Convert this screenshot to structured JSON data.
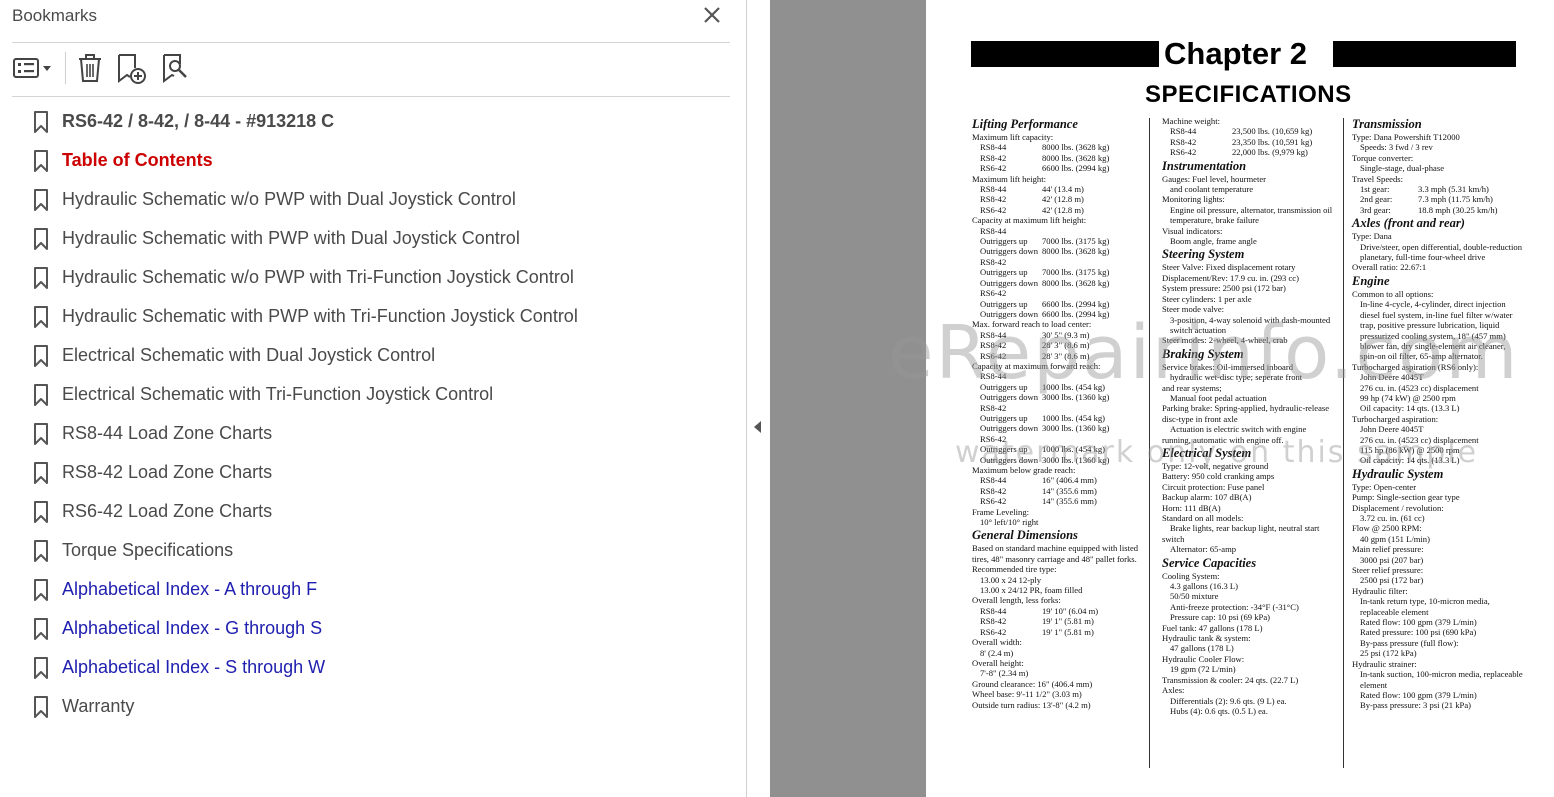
{
  "panel": {
    "title": "Bookmarks",
    "close_icon": "close-icon",
    "toolbar": [
      {
        "name": "options-menu-button",
        "icon": "list-options-icon"
      },
      {
        "name": "delete-bookmark-button",
        "icon": "trash-icon"
      },
      {
        "name": "new-bookmark-button",
        "icon": "add-bookmark-icon"
      },
      {
        "name": "find-bookmark-button",
        "icon": "search-bookmark-icon"
      }
    ],
    "bookmarks": [
      {
        "label": "RS6-42 / 8-42, / 8-44 - #913218 C",
        "style": "bold"
      },
      {
        "label": "Table of Contents",
        "style": "red"
      },
      {
        "label": "Hydraulic Schematic w/o PWP with Dual Joystick Control",
        "style": "normal"
      },
      {
        "label": "Hydraulic Schematic with PWP with Dual Joystick Control",
        "style": "normal"
      },
      {
        "label": "Hydraulic Schematic w/o PWP with Tri-Function Joystick Control",
        "style": "normal"
      },
      {
        "label": "Hydraulic Schematic with PWP with Tri-Function Joystick Control",
        "style": "normal"
      },
      {
        "label": "Electrical Schematic with Dual Joystick Control",
        "style": "normal"
      },
      {
        "label": "Electrical Schematic with Tri-Function Joystick Control",
        "style": "normal"
      },
      {
        "label": "RS8-44  Load Zone Charts",
        "style": "normal"
      },
      {
        "label": "RS8-42 Load Zone Charts",
        "style": "normal"
      },
      {
        "label": "RS6-42 Load Zone Charts",
        "style": "normal"
      },
      {
        "label": "Torque Specifications",
        "style": "normal"
      },
      {
        "label": "Alphabetical Index - A through F",
        "style": "blue"
      },
      {
        "label": "Alphabetical Index - G through S",
        "style": "blue"
      },
      {
        "label": "Alphabetical Index - S through W",
        "style": "blue"
      },
      {
        "label": "Warranty",
        "style": "normal"
      }
    ],
    "colors": {
      "red": "#cc0000",
      "blue": "#2020b0",
      "text": "#4a4a4a"
    }
  },
  "page": {
    "chapter": "Chapter 2",
    "title": "SPECIFICATIONS",
    "watermark": "eRepairinfo.com",
    "watermark_sub": "watermark only on this sample",
    "col1": [
      {
        "t": "h",
        "v": "Lifting Performance"
      },
      {
        "t": "p",
        "v": "Maximum lift capacity:"
      },
      {
        "t": "r",
        "a": "RS8-44",
        "b": "8000 lbs. (3628 kg)"
      },
      {
        "t": "r",
        "a": "RS8-42",
        "b": "8000 lbs. (3628 kg)"
      },
      {
        "t": "r",
        "a": "RS6-42",
        "b": "6600 lbs. (2994 kg)"
      },
      {
        "t": "p",
        "v": "Maximum lift height:"
      },
      {
        "t": "r",
        "a": "RS8-44",
        "b": "44' (13.4 m)"
      },
      {
        "t": "r",
        "a": "RS8-42",
        "b": "42' (12.8 m)"
      },
      {
        "t": "r",
        "a": "RS6-42",
        "b": "42' (12.8 m)"
      },
      {
        "t": "p",
        "v": "Capacity at maximum lift height:"
      },
      {
        "t": "i",
        "v": "RS8-44"
      },
      {
        "t": "r",
        "a": "Outriggers up",
        "b": "7000 lbs. (3175 kg)"
      },
      {
        "t": "r",
        "a": "Outriggers down",
        "b": "8000 lbs. (3628 kg)"
      },
      {
        "t": "i",
        "v": "RS8-42"
      },
      {
        "t": "r",
        "a": "Outriggers up",
        "b": "7000 lbs. (3175 kg)"
      },
      {
        "t": "r",
        "a": "Outriggers down",
        "b": "8000 lbs. (3628 kg)"
      },
      {
        "t": "i",
        "v": "RS6-42"
      },
      {
        "t": "r",
        "a": "Outriggers up",
        "b": "6600 lbs. (2994 kg)"
      },
      {
        "t": "r",
        "a": "Outriggers down",
        "b": "6600 lbs. (2994 kg)"
      },
      {
        "t": "p",
        "v": "Max. forward reach to load center:"
      },
      {
        "t": "r",
        "a": "RS8-44",
        "b": "30' 5\" (9.3 m)"
      },
      {
        "t": "r",
        "a": "RS8-42",
        "b": "28' 3\" (8.6 m)"
      },
      {
        "t": "r",
        "a": "RS6-42",
        "b": "28' 3\" (8.6 m)"
      },
      {
        "t": "p",
        "v": "Capacity at maximum forward reach:"
      },
      {
        "t": "i",
        "v": "RS8-44"
      },
      {
        "t": "r",
        "a": "Outriggers up",
        "b": "1000 lbs. (454 kg)"
      },
      {
        "t": "r",
        "a": "Outriggers down",
        "b": "3000 lbs. (1360 kg)"
      },
      {
        "t": "i",
        "v": "RS8-42"
      },
      {
        "t": "r",
        "a": "Outriggers up",
        "b": "1000 lbs. (454 kg)"
      },
      {
        "t": "r",
        "a": "Outriggers down",
        "b": "3000 lbs. (1360 kg)"
      },
      {
        "t": "i",
        "v": "RS6-42"
      },
      {
        "t": "r",
        "a": "Outriggers up",
        "b": "1000 lbs. (454 kg)"
      },
      {
        "t": "r",
        "a": "Outriggers down",
        "b": "3000 lbs. (1360 kg)"
      },
      {
        "t": "p",
        "v": "Maximum below grade reach:"
      },
      {
        "t": "r",
        "a": "RS8-44",
        "b": "16\" (406.4 mm)"
      },
      {
        "t": "r",
        "a": "RS8-42",
        "b": "14\" (355.6 mm)"
      },
      {
        "t": "r",
        "a": "RS6-42",
        "b": "14\" (355.6 mm)"
      },
      {
        "t": "p",
        "v": "Frame Leveling:"
      },
      {
        "t": "i",
        "v": "10° left/10° right"
      },
      {
        "t": "h",
        "v": "General Dimensions"
      },
      {
        "t": "p",
        "v": "Based on standard machine equipped with listed tires, 48\" masonry carriage and 48\" pallet forks."
      },
      {
        "t": "p",
        "v": "Recommended tire type:"
      },
      {
        "t": "i",
        "v": "13.00 x 24 12-ply"
      },
      {
        "t": "i",
        "v": "13.00 x 24/12 PR, foam filled"
      },
      {
        "t": "p",
        "v": "Overall length, less forks:"
      },
      {
        "t": "r",
        "a": "RS8-44",
        "b": "19' 10\" (6.04 m)"
      },
      {
        "t": "r",
        "a": "RS8-42",
        "b": "19' 1\" (5.81 m)"
      },
      {
        "t": "r",
        "a": "RS6-42",
        "b": "19' 1\" (5.81 m)"
      },
      {
        "t": "p",
        "v": "Overall width:"
      },
      {
        "t": "i",
        "v": "8' (2.4 m)"
      },
      {
        "t": "p",
        "v": "Overall height:"
      },
      {
        "t": "i",
        "v": "7'-8\" (2.34 m)"
      },
      {
        "t": "p",
        "v": "Ground clearance: 16\" (406.4 mm)"
      },
      {
        "t": "p",
        "v": "Wheel base: 9'-11 1/2\" (3.03 m)"
      },
      {
        "t": "p",
        "v": "Outside turn radius: 13'-8\" (4.2 m)"
      }
    ],
    "col2": [
      {
        "t": "p",
        "v": "Machine weight:"
      },
      {
        "t": "r",
        "a": "RS8-44",
        "b": "23,500 lbs. (10,659 kg)"
      },
      {
        "t": "r",
        "a": "RS8-42",
        "b": "23,350 lbs. (10,591 kg)"
      },
      {
        "t": "r",
        "a": "RS6-42",
        "b": "22,000 lbs. (9,979 kg)"
      },
      {
        "t": "h",
        "v": "Instrumentation"
      },
      {
        "t": "p",
        "v": "Gauges: Fuel level, hourmeter"
      },
      {
        "t": "i",
        "v": "and coolant temperature"
      },
      {
        "t": "p",
        "v": "Monitoring lights:"
      },
      {
        "t": "i",
        "v": "Engine oil pressure, alternator, transmission oil temperature, brake failure"
      },
      {
        "t": "p",
        "v": "Visual indicators:"
      },
      {
        "t": "i",
        "v": "Boom angle, frame angle"
      },
      {
        "t": "h",
        "v": "Steering System"
      },
      {
        "t": "p",
        "v": "Steer Valve: Fixed displacement rotary"
      },
      {
        "t": "p",
        "v": "Displacement/Rev: 17.9 cu. in. (293 cc)"
      },
      {
        "t": "p",
        "v": "System pressure: 2500 psi (172 bar)"
      },
      {
        "t": "p",
        "v": "Steer cylinders: 1 per axle"
      },
      {
        "t": "p",
        "v": "Steer mode valve:"
      },
      {
        "t": "i",
        "v": "3-position, 4-way solenoid with dash-mounted switch actuation"
      },
      {
        "t": "p",
        "v": "Steer modes: 2-wheel, 4-wheel, crab"
      },
      {
        "t": "h",
        "v": "Braking System"
      },
      {
        "t": "p",
        "v": "Service brakes: Oil-immersed inboard"
      },
      {
        "t": "i",
        "v": "hydraulic wet-disc type; seperate front"
      },
      {
        "t": "p",
        "v": "and rear systems;"
      },
      {
        "t": "i",
        "v": "Manual foot pedal actuation"
      },
      {
        "t": "p",
        "v": "Parking brake: Spring-applied, hydraulic-release disc-type in front axle"
      },
      {
        "t": "i",
        "v": "Actuation is electric switch with engine"
      },
      {
        "t": "p",
        "v": "running, automatic with engine off."
      },
      {
        "t": "h",
        "v": "Electrical System"
      },
      {
        "t": "p",
        "v": "Type: 12-volt, negative ground"
      },
      {
        "t": "p",
        "v": "Battery: 950 cold cranking amps"
      },
      {
        "t": "p",
        "v": "Circuit protection: Fuse panel"
      },
      {
        "t": "p",
        "v": "Backup alarm: 107 dB(A)"
      },
      {
        "t": "p",
        "v": "Horn: 111 dB(A)"
      },
      {
        "t": "p",
        "v": "Standard on all models:"
      },
      {
        "t": "i",
        "v": "Brake lights, rear backup light, neutral start"
      },
      {
        "t": "p",
        "v": "switch"
      },
      {
        "t": "i",
        "v": "Alternator: 65-amp"
      },
      {
        "t": "h",
        "v": "Service Capacities"
      },
      {
        "t": "p",
        "v": "Cooling System:"
      },
      {
        "t": "i",
        "v": "4.3 gallons (16.3 L)"
      },
      {
        "t": "i",
        "v": "50/50 mixture"
      },
      {
        "t": "i",
        "v": "Anti-freeze protection: -34°F (-31°C)"
      },
      {
        "t": "i",
        "v": "Pressure cap: 10 psi (69 kPa)"
      },
      {
        "t": "p",
        "v": "Fuel tank: 47 gallons (178 L)"
      },
      {
        "t": "p",
        "v": "Hydraulic tank & system:"
      },
      {
        "t": "i",
        "v": "47 gallons (178 L)"
      },
      {
        "t": "p",
        "v": "Hydraulic Cooler Flow:"
      },
      {
        "t": "i",
        "v": "19 gpm (72 L/min)"
      },
      {
        "t": "p",
        "v": "Transmission & cooler: 24 qts. (22.7 L)"
      },
      {
        "t": "p",
        "v": "Axles:"
      },
      {
        "t": "i",
        "v": "Differentials (2):   9.6 qts. (9 L) ea."
      },
      {
        "t": "i",
        "v": "Hubs (4): 0.6 qts. (0.5 L) ea."
      }
    ],
    "col3": [
      {
        "t": "h",
        "v": "Transmission"
      },
      {
        "t": "p",
        "v": "Type: Dana Powershift T12000"
      },
      {
        "t": "i",
        "v": "Speeds: 3 fwd / 3 rev"
      },
      {
        "t": "p",
        "v": "Torque converter:"
      },
      {
        "t": "i",
        "v": "Single-stage, dual-phase"
      },
      {
        "t": "p",
        "v": "Travel Speeds:"
      },
      {
        "t": "r",
        "a": "1st gear:",
        "b": "3.3 mph (5.31 km/h)"
      },
      {
        "t": "r",
        "a": "2nd gear:",
        "b": "7.3 mph (11.75 km/h)"
      },
      {
        "t": "r",
        "a": "3rd gear:",
        "b": "18.8 mph (30.25 km/h)"
      },
      {
        "t": "h",
        "v": "Axles (front and rear)"
      },
      {
        "t": "p",
        "v": "Type: Dana"
      },
      {
        "t": "i",
        "v": "Drive/steer, open differential, double-reduction planetary, full-time four-wheel drive"
      },
      {
        "t": "p",
        "v": "Overall ratio: 22.67:1"
      },
      {
        "t": "h",
        "v": "Engine"
      },
      {
        "t": "p",
        "v": "Common to all options:"
      },
      {
        "t": "i",
        "v": "In-line 4-cycle, 4-cylinder, direct injection diesel fuel system, in-line fuel filter w/water trap, positive pressure lubrication, liquid pressurized cooling system, 18\" (457 mm) blower fan, dry single-element air cleaner, spin-on oil filter, 65-amp alternator."
      },
      {
        "t": "p",
        "v": "Turbocharged aspiration (RS6 only):"
      },
      {
        "t": "i",
        "v": "John Deere 4045T"
      },
      {
        "t": "i",
        "v": "276 cu. in. (4523 cc) displacement"
      },
      {
        "t": "i",
        "v": "99 hp (74 kW) @ 2500 rpm"
      },
      {
        "t": "i",
        "v": "Oil capacity: 14 qts. (13.3 L)"
      },
      {
        "t": "p",
        "v": "Turbocharged aspiration:"
      },
      {
        "t": "i",
        "v": "John Deere 4045T"
      },
      {
        "t": "i",
        "v": "276 cu. in. (4523 cc) displacement"
      },
      {
        "t": "i",
        "v": "115 hp (86 kW) @ 2500 rpm"
      },
      {
        "t": "i",
        "v": "Oil capacity: 14 qts. (13.3 L)"
      },
      {
        "t": "h",
        "v": "Hydraulic System"
      },
      {
        "t": "p",
        "v": "Type: Open-center"
      },
      {
        "t": "p",
        "v": "Pump: Single-section gear type"
      },
      {
        "t": "p",
        "v": "Displacement / revolution:"
      },
      {
        "t": "i",
        "v": "3.72 cu. in. (61 cc)"
      },
      {
        "t": "p",
        "v": "Flow @ 2500 RPM:"
      },
      {
        "t": "i",
        "v": "40 gpm (151 L/min)"
      },
      {
        "t": "p",
        "v": "Main relief pressure:"
      },
      {
        "t": "i",
        "v": "3000 psi (207 bar)"
      },
      {
        "t": "p",
        "v": "Steer relief pressure:"
      },
      {
        "t": "i",
        "v": "2500 psi (172 bar)"
      },
      {
        "t": "p",
        "v": "Hydraulic filter:"
      },
      {
        "t": "i",
        "v": "In-tank return type, 10-micron media, replaceable element"
      },
      {
        "t": "i",
        "v": "Rated flow: 100 gpm (379 L/min)"
      },
      {
        "t": "i",
        "v": "Rated pressure: 100 psi (690 kPa)"
      },
      {
        "t": "i",
        "v": "By-pass pressure (full flow):"
      },
      {
        "t": "i",
        "v": "25 psi (172 kPa)"
      },
      {
        "t": "p",
        "v": "Hydraulic strainer:"
      },
      {
        "t": "i",
        "v": "In-tank suction, 100-micron media, replaceable element"
      },
      {
        "t": "i",
        "v": "Rated flow: 100 gpm (379 L/min)"
      },
      {
        "t": "i",
        "v": "By-pass pressure: 3 psi (21 kPa)"
      }
    ]
  }
}
